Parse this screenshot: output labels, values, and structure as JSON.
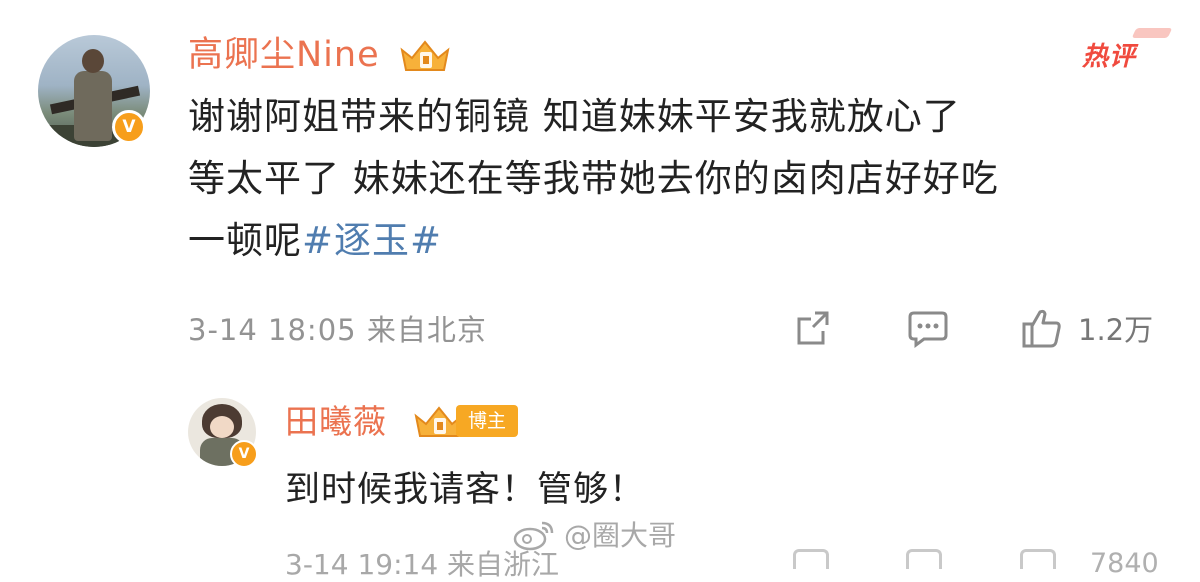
{
  "main_comment": {
    "username": "高卿尘Nine",
    "hot_label": "热评",
    "text_lines": [
      "谢谢阿姐带来的铜镜  知道妹妹平安我就放心了",
      "等太平了 妹妹还在等我带她去你的卤肉店好好吃",
      "一顿呢"
    ],
    "hashtag": "#逐玉#",
    "meta": "3-14 18:05  来自北京",
    "like_count": "1.2万",
    "icons": [
      "share-icon",
      "comment-icon",
      "like-icon",
      "crown-icon",
      "verified-icon"
    ]
  },
  "reply": {
    "username": "田曦薇",
    "tag": "博主",
    "text": "到时候我请客！管够！",
    "meta": "3-14 19:14  来自浙江",
    "like_count": "7840"
  },
  "watermark": "@圈大哥",
  "colors": {
    "username": "#eb7350",
    "hashtag": "#507daf",
    "hot": "#f04a3e",
    "verified": "#f79e1b",
    "meta": "#939393"
  }
}
